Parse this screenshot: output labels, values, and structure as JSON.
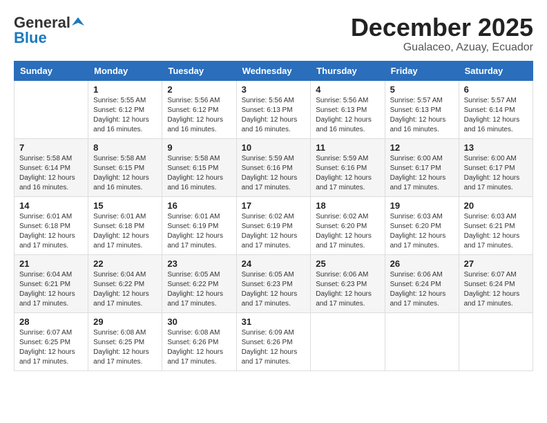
{
  "header": {
    "logo_general": "General",
    "logo_blue": "Blue",
    "month_title": "December 2025",
    "location": "Gualaceo, Azuay, Ecuador"
  },
  "days_of_week": [
    "Sunday",
    "Monday",
    "Tuesday",
    "Wednesday",
    "Thursday",
    "Friday",
    "Saturday"
  ],
  "weeks": [
    [
      {
        "day": "",
        "sunrise": "",
        "sunset": "",
        "daylight": ""
      },
      {
        "day": "1",
        "sunrise": "Sunrise: 5:55 AM",
        "sunset": "Sunset: 6:12 PM",
        "daylight": "Daylight: 12 hours and 16 minutes."
      },
      {
        "day": "2",
        "sunrise": "Sunrise: 5:56 AM",
        "sunset": "Sunset: 6:12 PM",
        "daylight": "Daylight: 12 hours and 16 minutes."
      },
      {
        "day": "3",
        "sunrise": "Sunrise: 5:56 AM",
        "sunset": "Sunset: 6:13 PM",
        "daylight": "Daylight: 12 hours and 16 minutes."
      },
      {
        "day": "4",
        "sunrise": "Sunrise: 5:56 AM",
        "sunset": "Sunset: 6:13 PM",
        "daylight": "Daylight: 12 hours and 16 minutes."
      },
      {
        "day": "5",
        "sunrise": "Sunrise: 5:57 AM",
        "sunset": "Sunset: 6:13 PM",
        "daylight": "Daylight: 12 hours and 16 minutes."
      },
      {
        "day": "6",
        "sunrise": "Sunrise: 5:57 AM",
        "sunset": "Sunset: 6:14 PM",
        "daylight": "Daylight: 12 hours and 16 minutes."
      }
    ],
    [
      {
        "day": "7",
        "sunrise": "Sunrise: 5:58 AM",
        "sunset": "Sunset: 6:14 PM",
        "daylight": "Daylight: 12 hours and 16 minutes."
      },
      {
        "day": "8",
        "sunrise": "Sunrise: 5:58 AM",
        "sunset": "Sunset: 6:15 PM",
        "daylight": "Daylight: 12 hours and 16 minutes."
      },
      {
        "day": "9",
        "sunrise": "Sunrise: 5:58 AM",
        "sunset": "Sunset: 6:15 PM",
        "daylight": "Daylight: 12 hours and 16 minutes."
      },
      {
        "day": "10",
        "sunrise": "Sunrise: 5:59 AM",
        "sunset": "Sunset: 6:16 PM",
        "daylight": "Daylight: 12 hours and 17 minutes."
      },
      {
        "day": "11",
        "sunrise": "Sunrise: 5:59 AM",
        "sunset": "Sunset: 6:16 PM",
        "daylight": "Daylight: 12 hours and 17 minutes."
      },
      {
        "day": "12",
        "sunrise": "Sunrise: 6:00 AM",
        "sunset": "Sunset: 6:17 PM",
        "daylight": "Daylight: 12 hours and 17 minutes."
      },
      {
        "day": "13",
        "sunrise": "Sunrise: 6:00 AM",
        "sunset": "Sunset: 6:17 PM",
        "daylight": "Daylight: 12 hours and 17 minutes."
      }
    ],
    [
      {
        "day": "14",
        "sunrise": "Sunrise: 6:01 AM",
        "sunset": "Sunset: 6:18 PM",
        "daylight": "Daylight: 12 hours and 17 minutes."
      },
      {
        "day": "15",
        "sunrise": "Sunrise: 6:01 AM",
        "sunset": "Sunset: 6:18 PM",
        "daylight": "Daylight: 12 hours and 17 minutes."
      },
      {
        "day": "16",
        "sunrise": "Sunrise: 6:01 AM",
        "sunset": "Sunset: 6:19 PM",
        "daylight": "Daylight: 12 hours and 17 minutes."
      },
      {
        "day": "17",
        "sunrise": "Sunrise: 6:02 AM",
        "sunset": "Sunset: 6:19 PM",
        "daylight": "Daylight: 12 hours and 17 minutes."
      },
      {
        "day": "18",
        "sunrise": "Sunrise: 6:02 AM",
        "sunset": "Sunset: 6:20 PM",
        "daylight": "Daylight: 12 hours and 17 minutes."
      },
      {
        "day": "19",
        "sunrise": "Sunrise: 6:03 AM",
        "sunset": "Sunset: 6:20 PM",
        "daylight": "Daylight: 12 hours and 17 minutes."
      },
      {
        "day": "20",
        "sunrise": "Sunrise: 6:03 AM",
        "sunset": "Sunset: 6:21 PM",
        "daylight": "Daylight: 12 hours and 17 minutes."
      }
    ],
    [
      {
        "day": "21",
        "sunrise": "Sunrise: 6:04 AM",
        "sunset": "Sunset: 6:21 PM",
        "daylight": "Daylight: 12 hours and 17 minutes."
      },
      {
        "day": "22",
        "sunrise": "Sunrise: 6:04 AM",
        "sunset": "Sunset: 6:22 PM",
        "daylight": "Daylight: 12 hours and 17 minutes."
      },
      {
        "day": "23",
        "sunrise": "Sunrise: 6:05 AM",
        "sunset": "Sunset: 6:22 PM",
        "daylight": "Daylight: 12 hours and 17 minutes."
      },
      {
        "day": "24",
        "sunrise": "Sunrise: 6:05 AM",
        "sunset": "Sunset: 6:23 PM",
        "daylight": "Daylight: 12 hours and 17 minutes."
      },
      {
        "day": "25",
        "sunrise": "Sunrise: 6:06 AM",
        "sunset": "Sunset: 6:23 PM",
        "daylight": "Daylight: 12 hours and 17 minutes."
      },
      {
        "day": "26",
        "sunrise": "Sunrise: 6:06 AM",
        "sunset": "Sunset: 6:24 PM",
        "daylight": "Daylight: 12 hours and 17 minutes."
      },
      {
        "day": "27",
        "sunrise": "Sunrise: 6:07 AM",
        "sunset": "Sunset: 6:24 PM",
        "daylight": "Daylight: 12 hours and 17 minutes."
      }
    ],
    [
      {
        "day": "28",
        "sunrise": "Sunrise: 6:07 AM",
        "sunset": "Sunset: 6:25 PM",
        "daylight": "Daylight: 12 hours and 17 minutes."
      },
      {
        "day": "29",
        "sunrise": "Sunrise: 6:08 AM",
        "sunset": "Sunset: 6:25 PM",
        "daylight": "Daylight: 12 hours and 17 minutes."
      },
      {
        "day": "30",
        "sunrise": "Sunrise: 6:08 AM",
        "sunset": "Sunset: 6:26 PM",
        "daylight": "Daylight: 12 hours and 17 minutes."
      },
      {
        "day": "31",
        "sunrise": "Sunrise: 6:09 AM",
        "sunset": "Sunset: 6:26 PM",
        "daylight": "Daylight: 12 hours and 17 minutes."
      },
      {
        "day": "",
        "sunrise": "",
        "sunset": "",
        "daylight": ""
      },
      {
        "day": "",
        "sunrise": "",
        "sunset": "",
        "daylight": ""
      },
      {
        "day": "",
        "sunrise": "",
        "sunset": "",
        "daylight": ""
      }
    ]
  ]
}
